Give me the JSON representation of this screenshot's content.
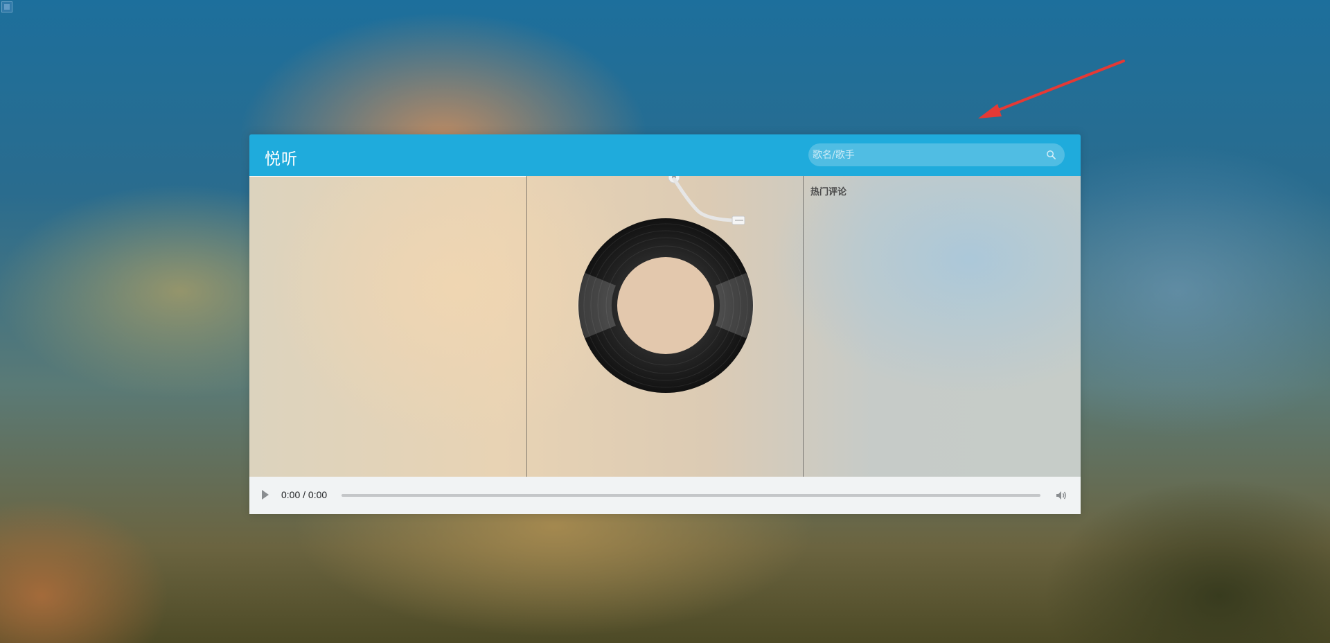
{
  "app": {
    "title": "悦听"
  },
  "search": {
    "placeholder": "歌名/歌手",
    "value": "",
    "icon": "search-icon"
  },
  "comments": {
    "heading": "热门评论"
  },
  "player": {
    "time": "0:00 / 0:00",
    "progress": 0,
    "play_icon": "play-icon",
    "volume_icon": "volume-icon"
  },
  "colors": {
    "header": "#1fabdc",
    "audio_bar": "#f1f3f4",
    "annotation_arrow": "#e53935"
  }
}
